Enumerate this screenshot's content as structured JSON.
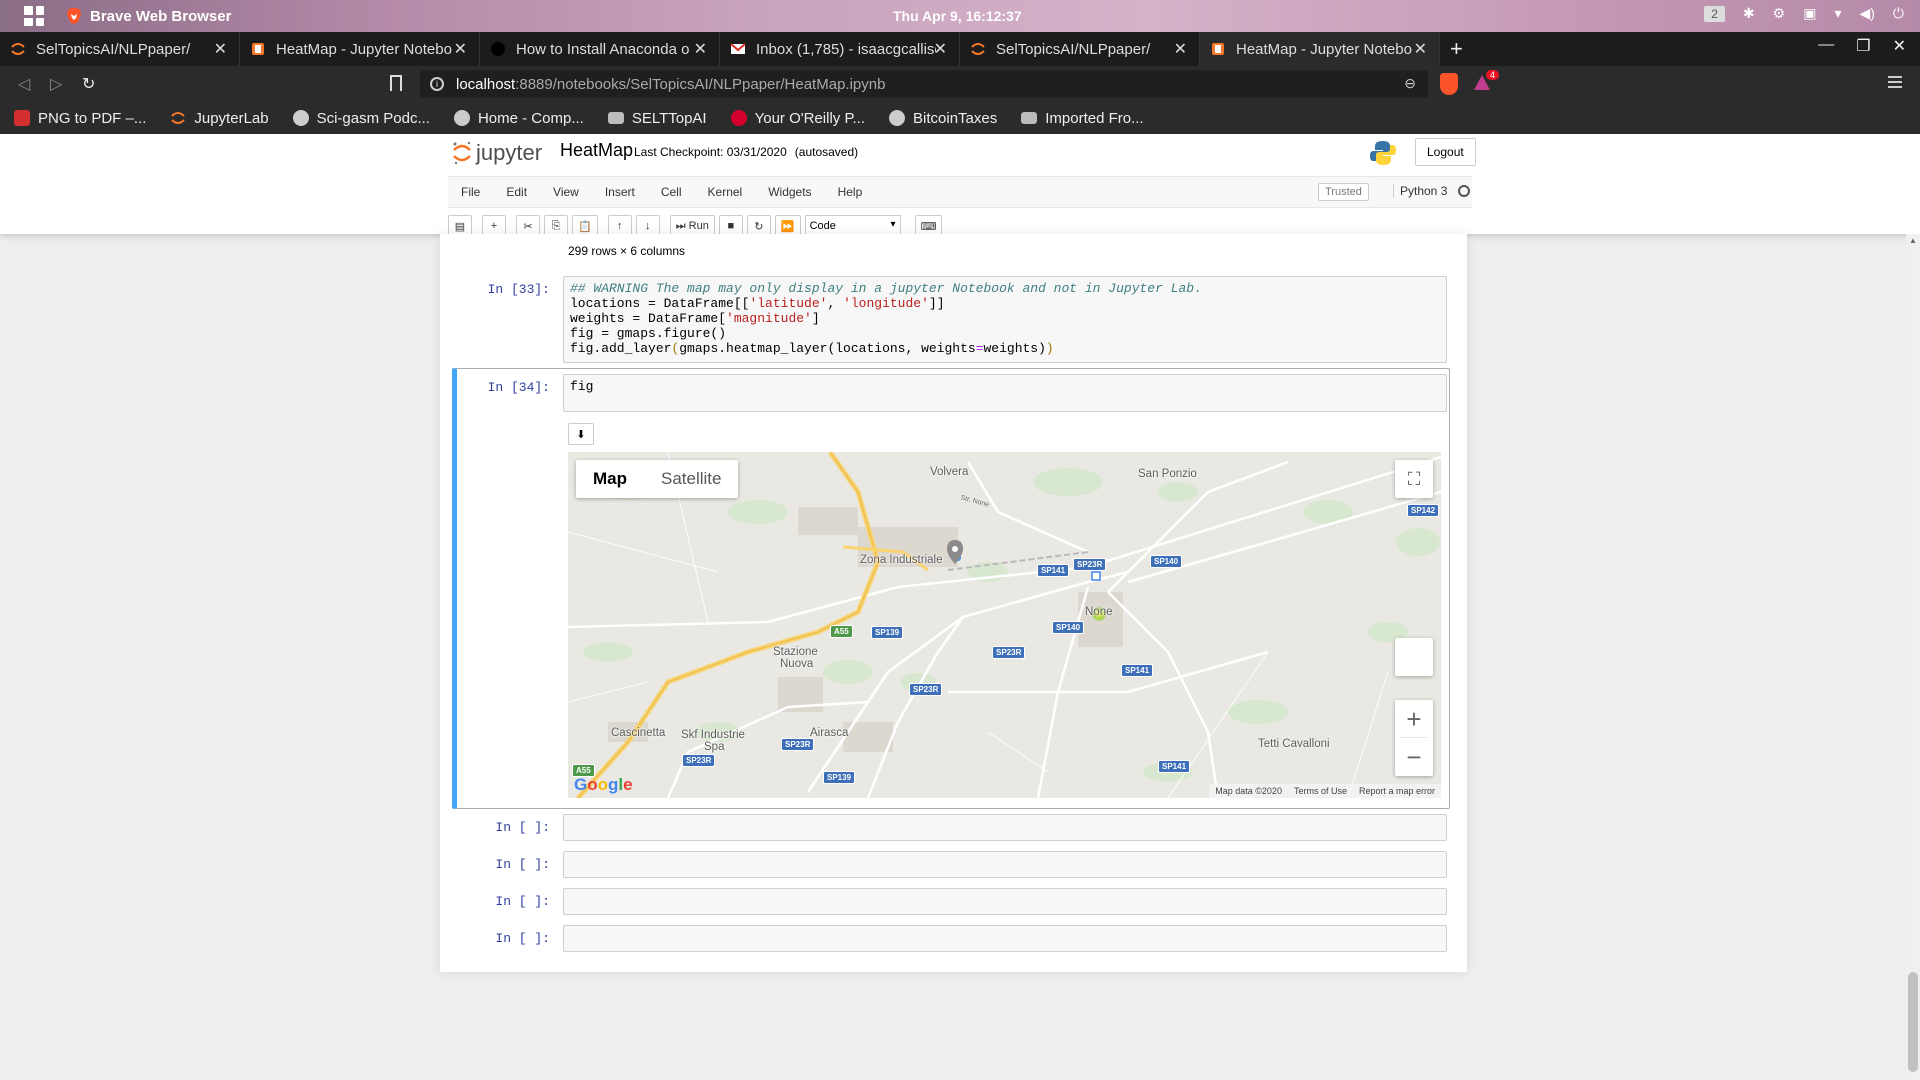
{
  "system": {
    "app_name": "Brave Web Browser",
    "clock": "Thu Apr  9, 16:12:37",
    "workspace": "2"
  },
  "tabs": [
    {
      "title": "SelTopicsAI/NLPpaper/",
      "favicon": "jupyter-icon",
      "active": false
    },
    {
      "title": "HeatMap - Jupyter Notebo",
      "favicon": "notebook-icon",
      "active": false
    },
    {
      "title": "How to Install Anaconda o",
      "favicon": "github-icon",
      "active": false
    },
    {
      "title": "Inbox (1,785) - isaacgcalliso",
      "favicon": "gmail-icon",
      "active": false
    },
    {
      "title": "SelTopicsAI/NLPpaper/",
      "favicon": "jupyter-icon",
      "active": false
    },
    {
      "title": "HeatMap - Jupyter Notebo",
      "favicon": "notebook-icon",
      "active": true
    }
  ],
  "address": {
    "host": "localhost",
    "path": ":8889/notebooks/SelTopicsAI/NLPpaper/HeatMap.ipynb",
    "rewards_badge": "4"
  },
  "bookmarks": [
    {
      "label": "PNG to PDF –...",
      "icon": "pdf-icon"
    },
    {
      "label": "JupyterLab",
      "icon": "jupyter-icon"
    },
    {
      "label": "Sci-gasm Podc...",
      "icon": "globe-icon"
    },
    {
      "label": "Home - Comp...",
      "icon": "globe-icon"
    },
    {
      "label": "SELTTopAI",
      "icon": "folder-icon"
    },
    {
      "label": "Your O'Reilly P...",
      "icon": "oreilly-icon"
    },
    {
      "label": "BitcoinTaxes",
      "icon": "globe-icon"
    },
    {
      "label": "Imported Fro...",
      "icon": "folder-icon"
    }
  ],
  "jupyter": {
    "logo_text": "jupyter",
    "notebook_name": "HeatMap",
    "checkpoint": "Last Checkpoint: 03/31/2020",
    "autosaved": "(autosaved)",
    "logout": "Logout",
    "menu": [
      "File",
      "Edit",
      "View",
      "Insert",
      "Cell",
      "Kernel",
      "Widgets",
      "Help"
    ],
    "trusted": "Trusted",
    "kernel": "Python 3",
    "run_label": "Run",
    "cell_type": "Code"
  },
  "notebook": {
    "rows_info": "299 rows × 6 columns",
    "cell33_prompt": "In [33]:",
    "cell33_lines": {
      "l1": "## WARNING The map may only display in a jupyter Notebook and not in Jupyter Lab.",
      "l2a": "locations = DataFrame[[",
      "l2b": "'latitude'",
      "l2c": ", ",
      "l2d": "'longitude'",
      "l2e": "]]",
      "l3a": "weights = DataFrame[",
      "l3b": "'magnitude'",
      "l3c": "]",
      "l4": "fig = gmaps.figure()",
      "l5a": "fig.add_layer",
      "l5b": "(",
      "l5c": "gmaps.heatmap_layer(locations, weights",
      "l5d": "=",
      "l5e": "weights)",
      "l5f": ")"
    },
    "cell34_prompt": "In [34]:",
    "cell34_code": "fig",
    "empty_prompt": "In [ ]:"
  },
  "map": {
    "type_map": "Map",
    "type_satellite": "Satellite",
    "places": {
      "volvera": "Volvera",
      "san_ponzio": "San Ponzio",
      "zona_industriale": "Zona Industriale",
      "none": "None",
      "stazione": "Stazione",
      "nuova": "Nuova",
      "cascinetta": "Cascinetta",
      "skf1": "Skf Industrie",
      "skf2": "Spa",
      "airasca": "Airasca",
      "tetti": "Tetti Cavalloni",
      "str_none": "Str. None"
    },
    "roads": {
      "sp142": "SP142",
      "sp141a": "SP141",
      "sp23r_a": "SP23R",
      "sp140a": "SP140",
      "sp140b": "SP140",
      "a55a": "A55",
      "sp139a": "SP139",
      "sp23r_b": "SP23R",
      "sp141b": "SP141",
      "sp23r_c": "SP23R",
      "sp23r_d": "SP23R",
      "sp23r_e": "SP23R",
      "a55b": "A55",
      "sp139b": "SP139",
      "sp141c": "SP141"
    },
    "footer_data": "Map data ©2020",
    "footer_terms": "Terms of Use",
    "footer_report": "Report a map error",
    "google": "Google",
    "colors": {
      "land": "#eae8e3",
      "green": "#d6e8cd",
      "road_motorway": "#f8d36e",
      "road_major": "#ffffff",
      "heat": "#e8e41e"
    }
  }
}
